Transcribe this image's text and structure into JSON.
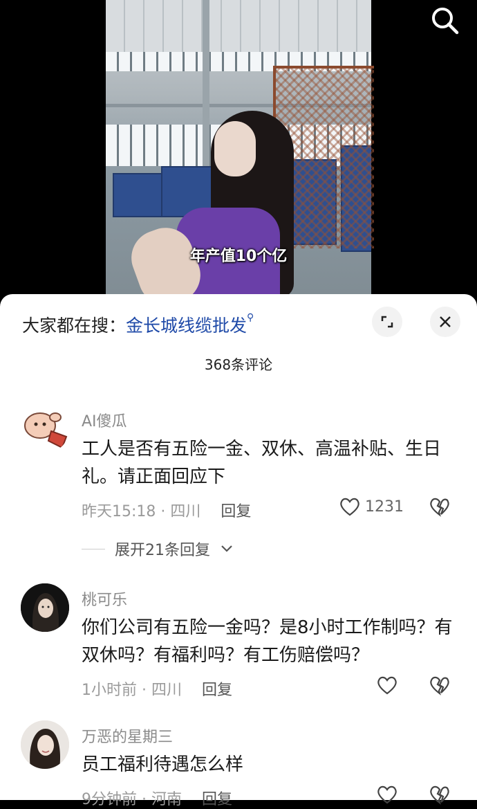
{
  "video": {
    "caption": "年产值10个亿"
  },
  "sheet": {
    "hot_search_prefix": "大家都在搜：",
    "hot_search_term": "金长城线缆批发",
    "comment_count": "368条评论"
  },
  "comments": [
    {
      "username": "AI傻瓜",
      "text": "工人是否有五险一金、双休、高温补贴、生日礼。请正面回应下",
      "time": "昨天15:18",
      "location": "四川",
      "reply_label": "回复",
      "likes": "1231",
      "expand_replies": "展开21条回复"
    },
    {
      "username": "桃可乐",
      "text": "你们公司有五险一金吗？是8小时工作制吗？有双休吗？有福利吗？有工伤赔偿吗？",
      "time": "1小时前",
      "location": "四川",
      "reply_label": "回复"
    },
    {
      "username": "万恶的星期三",
      "text": "员工福利待遇怎么样",
      "time": "9分钟前",
      "location": "河南",
      "reply_label": "回复"
    }
  ],
  "icons": {
    "search": "search-icon",
    "expand": "expand-icon",
    "close": "close-icon",
    "heart": "heart-icon",
    "broken_heart": "broken-heart-icon",
    "chevron": "chevron-down-icon"
  },
  "colors": {
    "link_blue": "#1f4aa8",
    "meta_gray": "#9a9a9a"
  }
}
